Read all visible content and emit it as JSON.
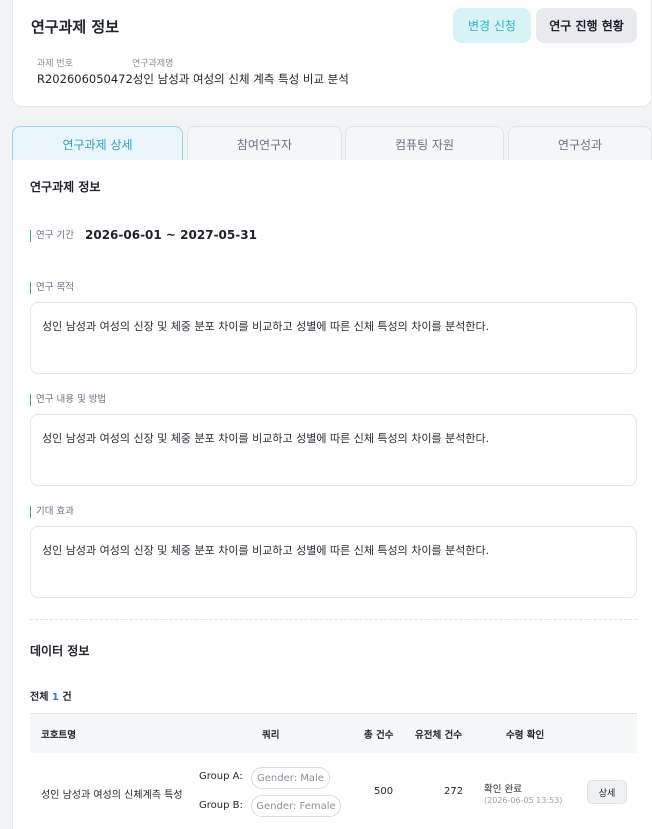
{
  "header": {
    "title": "연구과제 정보",
    "change_request_label": "변경 신청",
    "progress_status_label": "연구 진행 현황",
    "project_no_label": "과제 번호",
    "project_name_label": "연구과제명",
    "project_no": "R202606050472",
    "project_name": "성인 남성과 여성의 신체 계측 특성 비교 분석"
  },
  "tabs": [
    {
      "label": "연구과제 상세",
      "active": true
    },
    {
      "label": "참여연구자",
      "active": false
    },
    {
      "label": "컴퓨팅 자원",
      "active": false
    },
    {
      "label": "연구성과",
      "active": false
    }
  ],
  "detail": {
    "section_title": "연구과제 정보",
    "period_label": "연구 기간",
    "period_value": "2026-06-01 ~ 2027-05-31",
    "purpose_label": "연구 목적",
    "purpose_text": "성인 남성과 여성의 신장 및 체중 분포 차이를 비교하고 성별에 따른 신체 특성의 차이를 분석한다.",
    "method_label": "연구 내용 및 방법",
    "method_text": "성인 남성과 여성의 신장 및 체중 분포 차이를 비교하고 성별에 따른 신체 특성의 차이를 분석한다.",
    "effect_label": "기대 효과",
    "effect_text": "성인 남성과 여성의 신장 및 체중 분포 차이를 비교하고 성별에 따른 신체 특성의 차이를 분석한다."
  },
  "data_info": {
    "section_title": "데이터 정보",
    "total_prefix": "전체",
    "total_count": "1",
    "total_suffix": "건",
    "columns": {
      "cohort": "코호트명",
      "query": "쿼리",
      "total": "총 건수",
      "genome": "유전체 건수",
      "receipt": "수령 확인"
    },
    "rows": [
      {
        "cohort_name": "성인 남성과 여성의 신체계측 특성",
        "group_a_label": "Group A:",
        "group_a_query": "Gender: Male",
        "group_b_label": "Group B:",
        "group_b_query": "Gender: Female",
        "total": "500",
        "genome": "272",
        "status": "확인 완료",
        "status_date": "(2026-06-05 13:53)",
        "detail_label": "상세"
      }
    ]
  },
  "colors": {
    "accent": "#2aa3c4",
    "change_button_bg": "#d7f3f5",
    "count_highlight": "#2a7fd4"
  }
}
